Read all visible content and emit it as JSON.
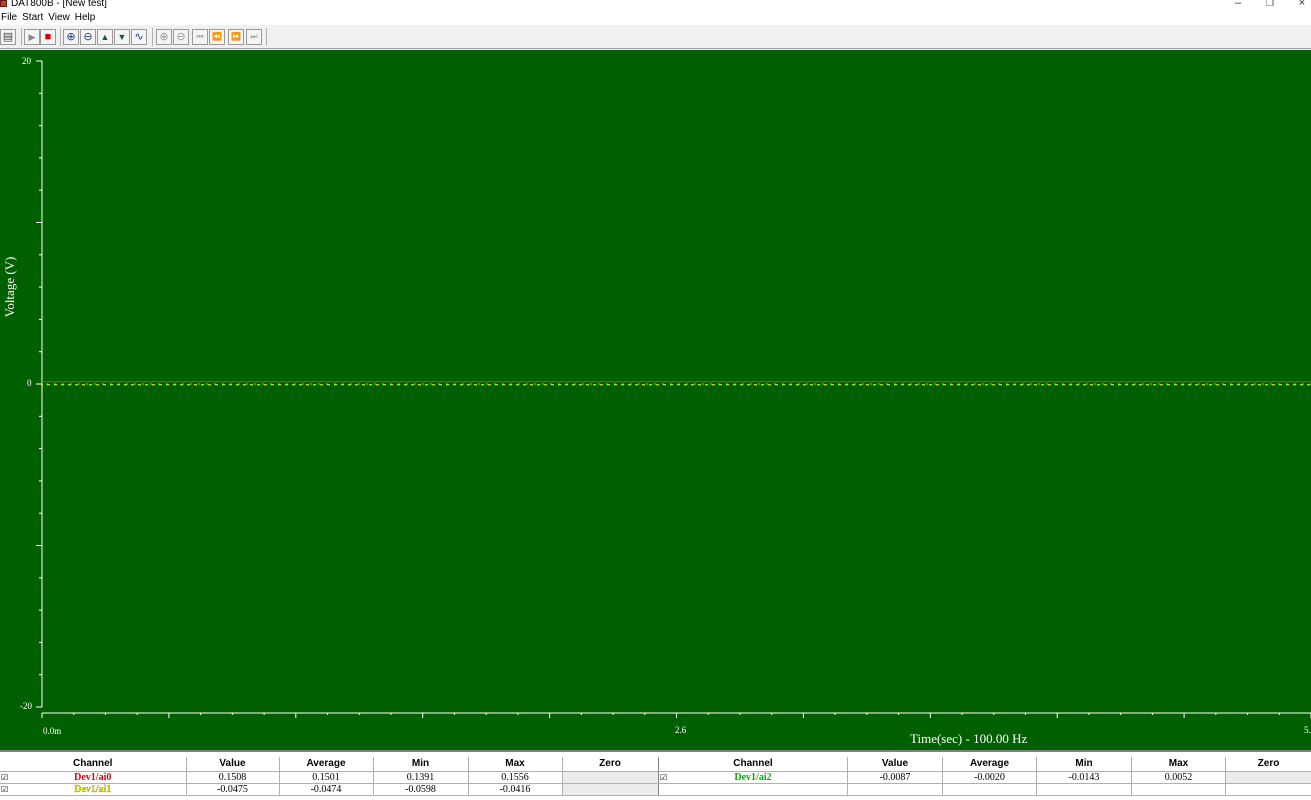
{
  "window": {
    "title": "DAT800B - [New test]",
    "minimize_glyph": "–",
    "restore_glyph": "❐",
    "close_glyph": "×"
  },
  "menu": [
    "File",
    "Start",
    "View",
    "Help"
  ],
  "toolbar": {
    "buttons": [
      {
        "name": "save-icon",
        "glyph": "▤"
      },
      {
        "name": "play-icon",
        "glyph": "▶"
      },
      {
        "name": "stop-icon",
        "glyph": "■"
      },
      {
        "name": "zoom-in-icon",
        "glyph": "⊕"
      },
      {
        "name": "zoom-out-icon",
        "glyph": "⊖"
      },
      {
        "name": "scale-up-icon",
        "glyph": "▲"
      },
      {
        "name": "scale-down-icon",
        "glyph": "▼"
      },
      {
        "name": "waveform-icon",
        "glyph": "∿"
      },
      {
        "name": "zoom-x-in-icon",
        "glyph": "⊕"
      },
      {
        "name": "zoom-x-out-icon",
        "glyph": "⊖"
      },
      {
        "name": "go-start-icon",
        "glyph": "⏮"
      },
      {
        "name": "rewind-icon",
        "glyph": "⏪"
      },
      {
        "name": "fast-forward-icon",
        "glyph": "⏩"
      },
      {
        "name": "go-end-icon",
        "glyph": "⏭"
      }
    ]
  },
  "colors": {
    "plot_background": "#006000",
    "trace_ai0": "#ff2020",
    "trace_ai1": "#ffff00",
    "trace_ai2": "#00ff40"
  },
  "chart_data": {
    "type": "line",
    "ylabel": "Voltage (V)",
    "xlabel": "Time(sec) - 100.00  Hz",
    "ylim": [
      -20,
      20
    ],
    "xlim": [
      0,
      5.2
    ],
    "y_tick_labels": [
      "20",
      "0",
      "-20"
    ],
    "x_tick_labels": [
      "0.0m",
      "2.6",
      "5."
    ],
    "grid": false,
    "series": [
      {
        "name": "Dev1/ai0",
        "color": "#ff2020",
        "x": [
          0,
          5.2
        ],
        "y": [
          0.1501,
          0.1501
        ]
      },
      {
        "name": "Dev1/ai1",
        "color": "#ffff00",
        "x": [
          0,
          5.2
        ],
        "y": [
          -0.0474,
          -0.0474
        ]
      },
      {
        "name": "Dev1/ai2",
        "color": "#00ff40",
        "x": [
          0,
          5.2
        ],
        "y": [
          -0.002,
          -0.002
        ]
      }
    ]
  },
  "table": {
    "headers": [
      "Channel",
      "Value",
      "Average",
      "Min",
      "Max",
      "Zero"
    ],
    "left_rows": [
      {
        "check": "☑",
        "channel": "Dev1/ai0",
        "color": "#e00000",
        "value": "0.1508",
        "average": "0.1501",
        "min": "0.1391",
        "max": "0.1556",
        "zero": ""
      },
      {
        "check": "☑",
        "channel": "Dev1/ai1",
        "color": "#e8e800",
        "value": "-0.0475",
        "average": "-0.0474",
        "min": "-0.0598",
        "max": "-0.0416",
        "zero": ""
      }
    ],
    "right_rows": [
      {
        "check": "☑",
        "channel": "Dev1/ai2",
        "color": "#00b000",
        "value": "-0.0087",
        "average": "-0.0020",
        "min": "-0.0143",
        "max": "0.0052",
        "zero": ""
      }
    ]
  }
}
